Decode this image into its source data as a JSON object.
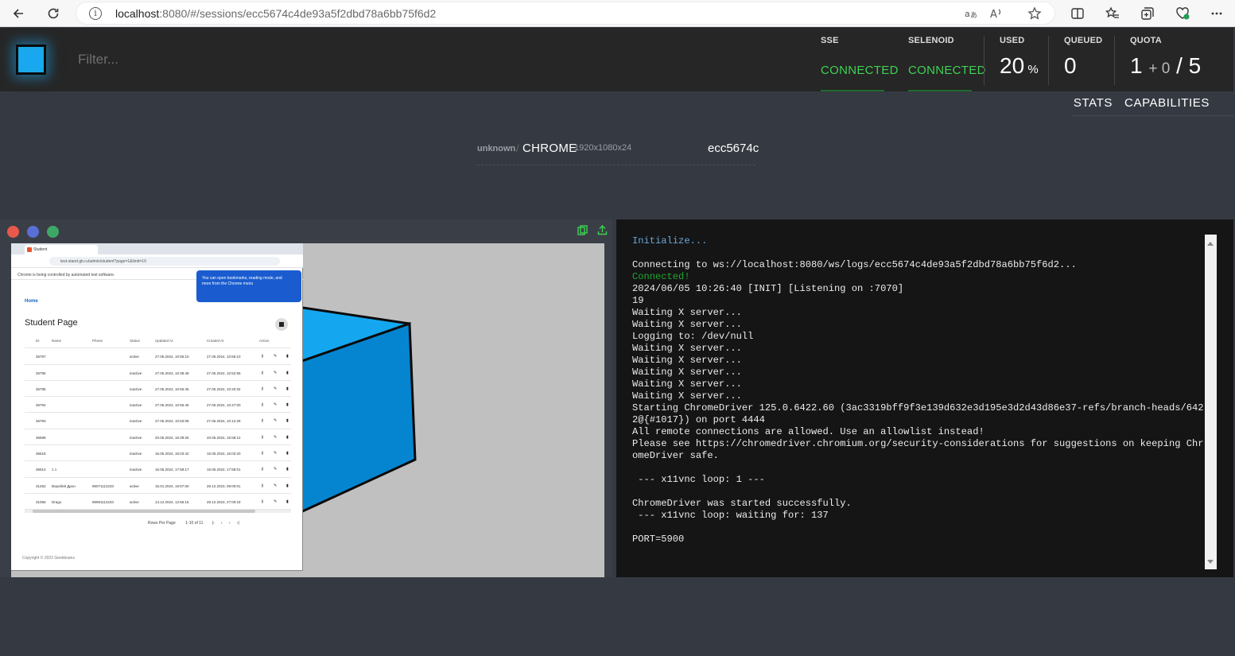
{
  "browser": {
    "url_host": "localhost",
    "url_rest": ":8080/#/sessions/ecc5674c4de93a5f2dbd78a6bb75f6d2"
  },
  "header": {
    "filter_placeholder": "Filter...",
    "sse": {
      "label": "SSE",
      "status": "CONNECTED"
    },
    "selenoid": {
      "label": "SELENOID",
      "status": "CONNECTED"
    },
    "used": {
      "label": "USED",
      "value": "20",
      "unit": "%"
    },
    "queued": {
      "label": "QUEUED",
      "value": "0"
    },
    "quota": {
      "label": "QUOTA",
      "used": "1",
      "pending": "+ 0",
      "sep": "/",
      "total": "5"
    },
    "status_color": "#3ed153",
    "accent": "#1aa9e6"
  },
  "tabs": [
    "STATS",
    "CAPABILITIES"
  ],
  "session": {
    "version": "unknown",
    "browser": "CHROME",
    "resolution": "1920x1080x24",
    "id": "ecc5674c"
  },
  "vnc": {
    "dots": [
      "#e8584b",
      "#5a6fd6",
      "#3da866"
    ],
    "inner": {
      "tab_title": "Student",
      "url": "test-stand.gb.ru/admin/student?page=1&limit=10",
      "notice": "Chrome is being controlled by automated test software.",
      "popup": "You can open bookmarks, reading mode, and more from the Chrome menu",
      "home": "Home",
      "title": "Student Page",
      "columns": [
        "ID",
        "Name",
        "Phone",
        "Status",
        "Updated At",
        "Created At",
        "Action"
      ],
      "rows": [
        [
          "36797",
          "",
          "",
          "active",
          "27.05.2024, 10:55:10",
          "27.05.2024, 10:55:10"
        ],
        [
          "36796",
          "",
          "",
          "inactive",
          "27.05.2024, 10:38:48",
          "27.05.2024, 10:52:55"
        ],
        [
          "36795",
          "",
          "",
          "inactive",
          "27.05.2024, 10:55:45",
          "27.05.2024, 10:40:32"
        ],
        [
          "36794",
          "",
          "",
          "inactive",
          "27.05.2024, 10:56:46",
          "27.05.2024, 10:47:00"
        ],
        [
          "36793",
          "",
          "",
          "inactive",
          "27.05.2024, 10:53:08",
          "27.05.2024, 10:12:28"
        ],
        [
          "36689",
          "",
          "",
          "inactive",
          "20.05.2024, 16:39:26",
          "20.05.2024, 16:59:12"
        ],
        [
          "36618",
          "",
          "",
          "inactive",
          "16.05.2024, 16:03:42",
          "16.05.2024, 16:03:20"
        ],
        [
          "36614",
          "1 1",
          "",
          "inactive",
          "16.05.2024, 17:58:17",
          "16.05.2024, 17:58:01"
        ],
        [
          "31252",
          "Воробей Дрон",
          "89071112233",
          "active",
          "15.01.2024, 19:57:00",
          "28.12.2023, 09:00:01"
        ],
        [
          "31055",
          "Drago",
          "89991112233",
          "active",
          "14.12.2024, 12:55:15",
          "28.12.2023, 27:00:18"
        ]
      ],
      "rows_per_page": "Rows Per Page",
      "range": "1-10 of 11",
      "footer": "Copyright © 2022 Geekbrains"
    }
  },
  "logs": {
    "lines": [
      {
        "text": "Initialize...",
        "kind": "info"
      },
      {
        "text": "",
        "kind": "plain"
      },
      {
        "text": "Connecting to ws://localhost:8080/ws/logs/ecc5674c4de93a5f2dbd78a6bb75f6d2...",
        "kind": "plain"
      },
      {
        "text": "Connected!",
        "kind": "ok"
      },
      {
        "text": "2024/06/05 10:26:40 [INIT] [Listening on :7070]",
        "kind": "plain"
      },
      {
        "text": "19",
        "kind": "plain"
      },
      {
        "text": "Waiting X server...",
        "kind": "plain"
      },
      {
        "text": "Waiting X server...",
        "kind": "plain"
      },
      {
        "text": "Logging to: /dev/null",
        "kind": "plain"
      },
      {
        "text": "Waiting X server...",
        "kind": "plain"
      },
      {
        "text": "Waiting X server...",
        "kind": "plain"
      },
      {
        "text": "Waiting X server...",
        "kind": "plain"
      },
      {
        "text": "Waiting X server...",
        "kind": "plain"
      },
      {
        "text": "Waiting X server...",
        "kind": "plain"
      },
      {
        "text": "Starting ChromeDriver 125.0.6422.60 (3ac3319bff9f3e139d632e3d195e3d2d43d86e37-refs/branch-heads/6422@{#1017}) on port 4444",
        "kind": "plain"
      },
      {
        "text": "All remote connections are allowed. Use an allowlist instead!",
        "kind": "plain"
      },
      {
        "text": "Please see https://chromedriver.chromium.org/security-considerations for suggestions on keeping ChromeDriver safe.",
        "kind": "plain"
      },
      {
        "text": "",
        "kind": "plain"
      },
      {
        "text": " --- x11vnc loop: 1 ---",
        "kind": "plain"
      },
      {
        "text": "",
        "kind": "plain"
      },
      {
        "text": "ChromeDriver was started successfully.",
        "kind": "plain"
      },
      {
        "text": " --- x11vnc loop: waiting for: 137",
        "kind": "plain"
      },
      {
        "text": "",
        "kind": "plain"
      },
      {
        "text": "PORT=5900",
        "kind": "plain"
      }
    ]
  }
}
